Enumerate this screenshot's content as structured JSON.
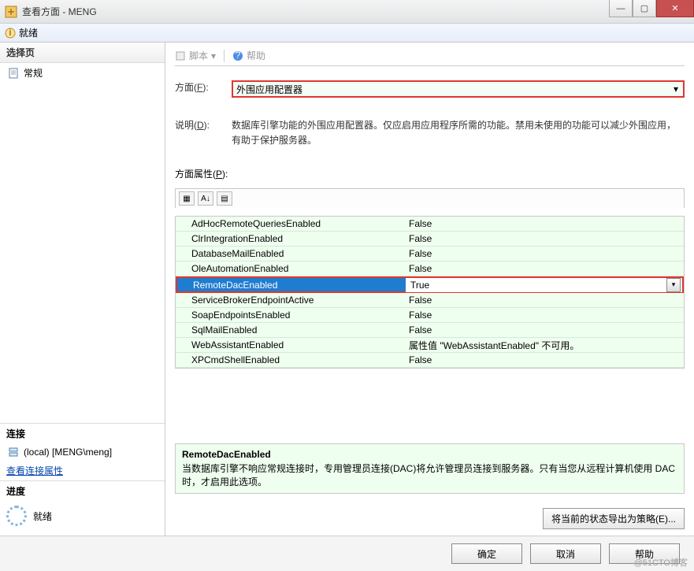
{
  "window": {
    "title": "查看方面 - MENG",
    "controls": {
      "min": "—",
      "max": "▢",
      "close": "✕"
    }
  },
  "infobar": {
    "text": "就绪"
  },
  "left": {
    "select_page": "选择页",
    "item_general": "常规",
    "connection_label": "连接",
    "connection_value": "(local) [MENG\\meng]",
    "view_conn_link": "查看连接属性",
    "progress_label": "进度",
    "progress_status": "就绪"
  },
  "toolbar": {
    "script": "脚本",
    "help": "帮助"
  },
  "form": {
    "facet_label_pre": "方面(",
    "facet_key": "F",
    "facet_label_post": "):",
    "facet_value": "外围应用配置器",
    "desc_label_pre": "说明(",
    "desc_key": "D",
    "desc_label_post": "):",
    "desc_value": "数据库引擎功能的外围应用配置器。仅应启用应用程序所需的功能。禁用未使用的功能可以减少外围应用，有助于保护服务器。",
    "props_label_pre": "方面属性(",
    "props_key": "P",
    "props_label_post": "):"
  },
  "properties": [
    {
      "name": "AdHocRemoteQueriesEnabled",
      "value": "False",
      "selected": false
    },
    {
      "name": "ClrIntegrationEnabled",
      "value": "False",
      "selected": false
    },
    {
      "name": "DatabaseMailEnabled",
      "value": "False",
      "selected": false
    },
    {
      "name": "OleAutomationEnabled",
      "value": "False",
      "selected": false
    },
    {
      "name": "RemoteDacEnabled",
      "value": "True",
      "selected": true
    },
    {
      "name": "ServiceBrokerEndpointActive",
      "value": "False",
      "selected": false
    },
    {
      "name": "SoapEndpointsEnabled",
      "value": "False",
      "selected": false
    },
    {
      "name": "SqlMailEnabled",
      "value": "False",
      "selected": false
    },
    {
      "name": "WebAssistantEnabled",
      "value": "属性值 \"WebAssistantEnabled\" 不可用。",
      "selected": false
    },
    {
      "name": "XPCmdShellEnabled",
      "value": "False",
      "selected": false
    }
  ],
  "helppanel": {
    "title": "RemoteDacEnabled",
    "text": "当数据库引擎不响应常规连接时，专用管理员连接(DAC)将允许管理员连接到服务器。只有当您从远程计算机使用 DAC 时，才启用此选项。"
  },
  "export_btn": "将当前的状态导出为策略(E)...",
  "buttons": {
    "ok": "确定",
    "cancel": "取消",
    "help": "帮助"
  },
  "watermark": "@51CTO博客"
}
